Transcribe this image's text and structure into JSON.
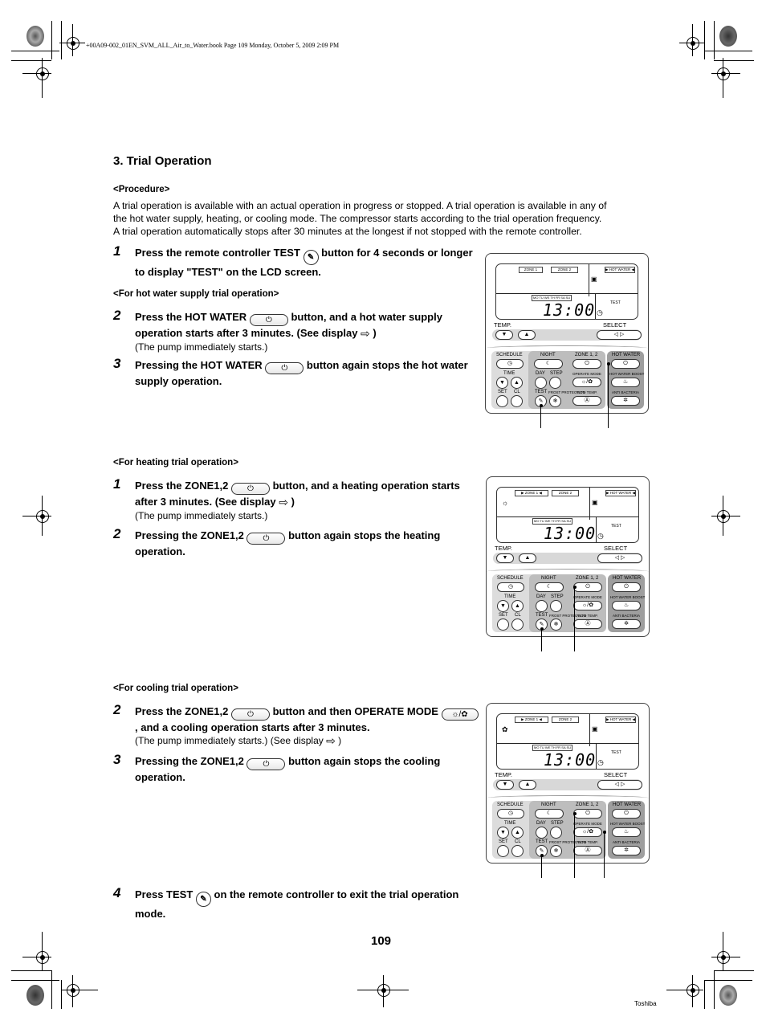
{
  "header_note": "+00A09-002_01EN_SVM_ALL_Air_to_Water.book  Page 109  Monday, October 5, 2009  2:09 PM",
  "section_title": "3. Trial Operation",
  "procedure": {
    "heading": "<Procedure>",
    "lines": [
      "A trial operation is available with an actual operation in progress or stopped. A trial operation is available in any of",
      "the hot water supply, heating, or cooling mode. The compressor starts according to the trial operation frequency.",
      "A trial operation automatically stops after 30 minutes at the longest if not stopped with the remote controller."
    ]
  },
  "icons": {
    "power": "⏻",
    "test_wrench": "✎",
    "see_display_arrow": "⇨",
    "mode_heat_cool": "☼/✿"
  },
  "step_intro": {
    "num": "1",
    "text_a": "Press the remote controller TEST",
    "text_b": "button for 4 seconds or longer to display \"TEST\" on the LCD screen."
  },
  "hot_water": {
    "heading": "<For hot water supply trial operation>",
    "steps": [
      {
        "num": "2",
        "text_a": "Press the HOT WATER",
        "text_b": "button, and a hot water supply operation starts after 3 minutes. (See display",
        "text_c": ")",
        "sub": "(The pump immediately starts.)"
      },
      {
        "num": "3",
        "text_a": "Pressing the HOT WATER",
        "text_b": "button again stops the hot water supply operation."
      }
    ]
  },
  "heating": {
    "heading": "<For heating trial operation>",
    "steps": [
      {
        "num": "1",
        "text_a": "Press the ZONE1,2",
        "text_b": "button, and a heating operation starts after 3 minutes. (See display",
        "text_c": ")",
        "sub": "(The pump immediately starts.)"
      },
      {
        "num": "2",
        "text_a": "Pressing the ZONE1,2",
        "text_b": "button again stops the heating operation."
      }
    ]
  },
  "cooling": {
    "heading": "<For cooling trial operation>",
    "steps": [
      {
        "num": "2",
        "text_a": "Press the ZONE1,2",
        "text_b": "button and then OPERATE MODE",
        "text_c": ", and a cooling operation starts after 3 minutes.",
        "sub_a": "(The pump immediately starts.) (See display",
        "sub_b": ")"
      },
      {
        "num": "3",
        "text_a": "Pressing the ZONE1,2",
        "text_b": "button again stops the cooling operation."
      }
    ]
  },
  "step_exit": {
    "num": "4",
    "text_a": "Press TEST",
    "text_b": "on the remote controller to exit the trial operation mode."
  },
  "remote": {
    "zone1": "ZONE 1",
    "zone1_active": "▶ ZONE 1 ◀",
    "zone2": "ZONE 2",
    "hot_water_tag": "▶ HOT WATER ◀",
    "days": "MO TU WE TH FR SA SU",
    "clock": "13:00",
    "lcd_test": "TEST",
    "temp": "TEMP.",
    "select": "SELECT",
    "down": "▼",
    "up": "▲",
    "left_right": "◁  ▷",
    "schedule": "SCHEDULE",
    "night": "NIGHT",
    "zone12": "ZONE 1, 2",
    "hot_water": "HOT WATER",
    "time": "TIME",
    "day": "DAY",
    "step": "STEP",
    "operate_mode": "OPERATE MODE",
    "hot_water_boost": "HOT WATER BOOST",
    "set": "SET",
    "cl": "CL",
    "test": "TEST",
    "frost_protection": "FROST PROTECTION",
    "auto_temp": "AUTO TEMP.",
    "anti_bacteria": "ANTI BACTERIA",
    "sym_schedule": "◷",
    "sym_night": "☾",
    "sym_power": "⏻",
    "sym_mode": "☼/✿",
    "sym_boost": "♨",
    "sym_test": "✎",
    "sym_frost": "❄",
    "sym_auto": "Ⓐ",
    "sym_anti": "✲",
    "sym_heat": "☼",
    "sym_cool": "✿"
  },
  "page_number": "109",
  "brand": "Toshiba"
}
